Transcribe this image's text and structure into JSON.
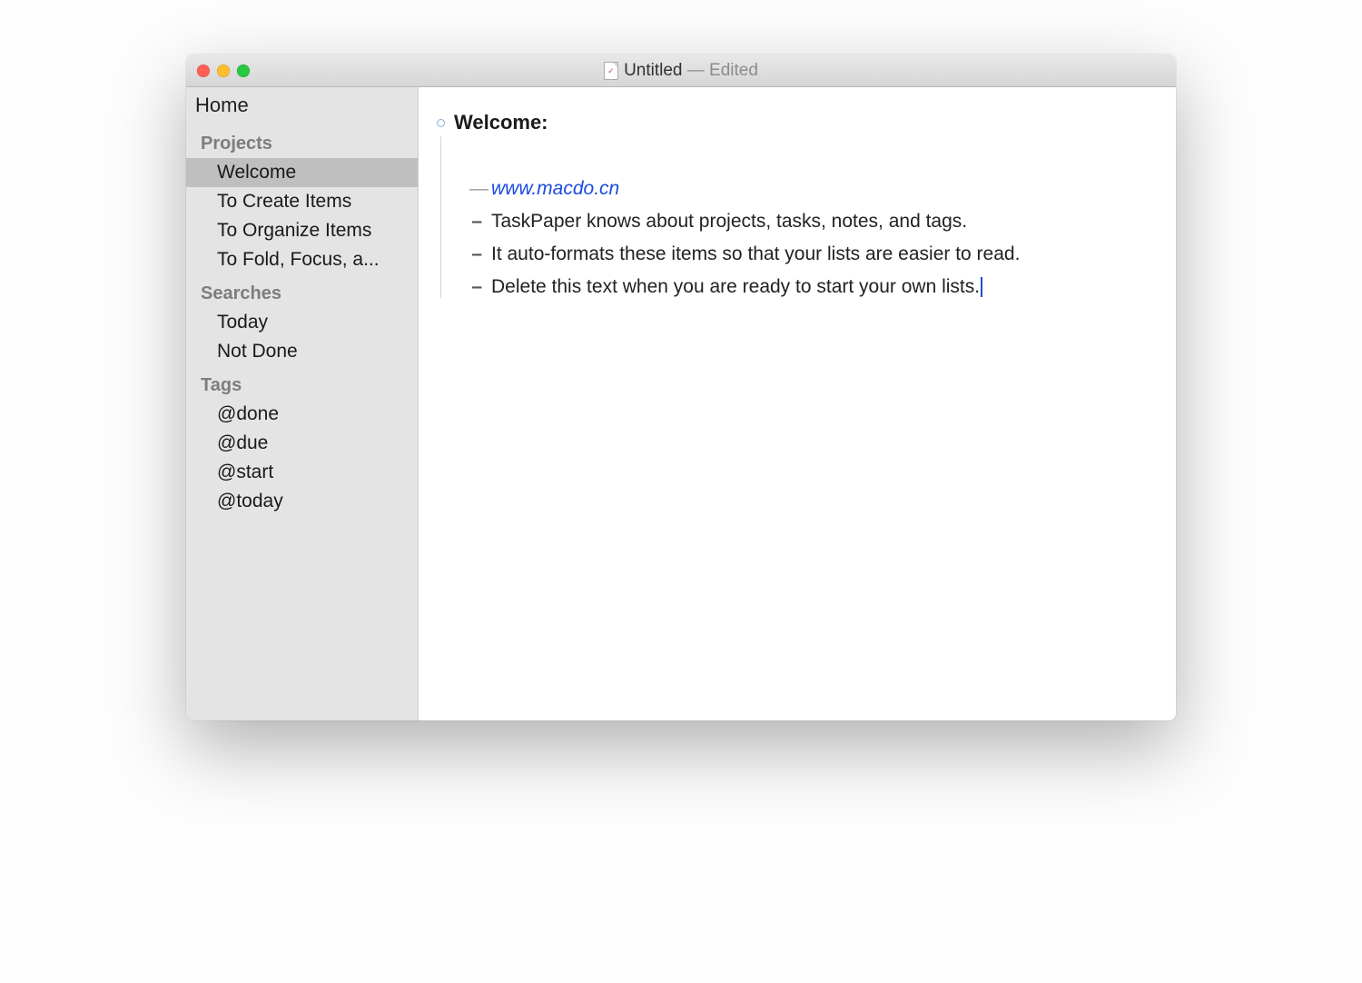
{
  "titlebar": {
    "doc_name": "Untitled",
    "suffix": " — Edited"
  },
  "sidebar": {
    "home": "Home",
    "sections": {
      "projects": {
        "header": "Projects",
        "items": [
          "Welcome",
          "To Create Items",
          "To Organize Items",
          "To Fold, Focus, a..."
        ]
      },
      "searches": {
        "header": "Searches",
        "items": [
          "Today",
          "Not Done"
        ]
      },
      "tags": {
        "header": "Tags",
        "items": [
          "@done",
          "@due",
          "@start",
          "@today"
        ]
      }
    },
    "selected": "Welcome"
  },
  "editor": {
    "heading": "Welcome:",
    "note_link": "www.macdo.cn",
    "tasks": [
      "TaskPaper knows about projects, tasks, notes, and tags.",
      "It auto-formats these items so that your lists are easier to read.",
      "Delete this text when you are ready to start your own lists."
    ]
  }
}
